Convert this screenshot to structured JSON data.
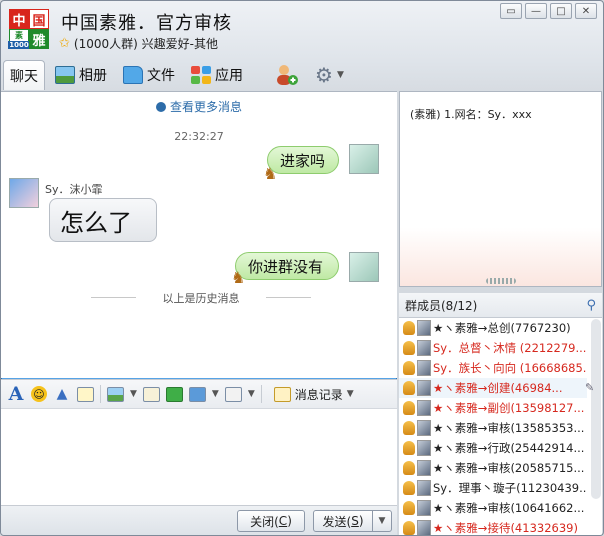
{
  "window": {
    "logo_chars": [
      "中",
      "国",
      "素",
      "雅"
    ],
    "logo_badge": "1000",
    "title": "中国素雅．官方审核",
    "subtitle": "(1000人群) 兴趣爱好-其他",
    "controls": {
      "pin": "▭",
      "minimize": "—",
      "maximize": "□",
      "close": "✕"
    }
  },
  "tabs": [
    {
      "label": "聊天",
      "icon": "chat-icon"
    },
    {
      "label": "相册",
      "icon": "album-icon"
    },
    {
      "label": "文件",
      "icon": "folder-icon"
    },
    {
      "label": "应用",
      "icon": "apps-icon"
    }
  ],
  "chat": {
    "more_link": "查看更多消息",
    "timestamp": "22:32:27",
    "messages": [
      {
        "side": "right",
        "text": "进家吗"
      },
      {
        "side": "left",
        "sender": "Sy．沫小霏",
        "text": "怎么了"
      },
      {
        "side": "right",
        "text": "你进群没有"
      }
    ],
    "history_divider": "以上是历史消息"
  },
  "input_toolbar": {
    "history_label": "消息记录"
  },
  "buttons": {
    "close_label": "关闭(",
    "close_key": "C",
    "send_label": "发送(",
    "send_key": "S"
  },
  "notice": {
    "text": "(素雅) 1.网名：Sy．xxx"
  },
  "members": {
    "header": "群成员(8/12)",
    "list": [
      {
        "name": "★ヽ素雅→总创(7767230)",
        "red": false
      },
      {
        "name": "Sy．总督丶沐情 (2212279...",
        "red": true
      },
      {
        "name": "Sy．族长丶向向 (16668685...",
        "red": true
      },
      {
        "name": "★ヽ素雅→创建(46984...",
        "red": true
      },
      {
        "name": "★ヽ素雅→副创(13598127...",
        "red": true
      },
      {
        "name": "★ヽ素雅→审核(13585353...",
        "red": false
      },
      {
        "name": "★ヽ素雅→行政(25442914...",
        "red": false
      },
      {
        "name": "★ヽ素雅→审核(20585715...",
        "red": false
      },
      {
        "name": "Sy．理事丶璇子(11230439...",
        "red": false
      },
      {
        "name": "★ヽ素雅→审核(10641662...",
        "red": false
      },
      {
        "name": "★ヽ素雅→接待(41332639)",
        "red": true
      }
    ]
  }
}
